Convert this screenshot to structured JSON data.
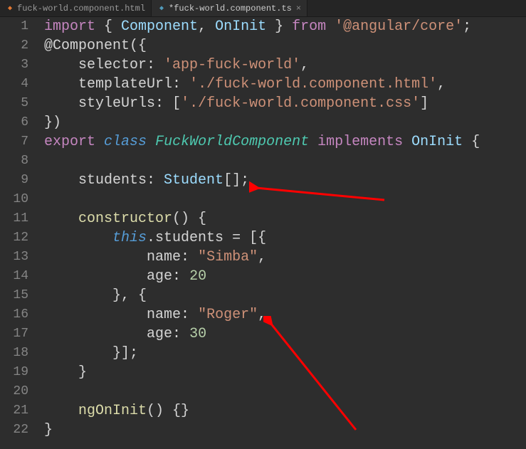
{
  "tabs": [
    {
      "label": "fuck-world.component.html",
      "modified": false,
      "active": false,
      "iconColor": "#e37933"
    },
    {
      "label": "*fuck-world.component.ts",
      "modified": true,
      "active": true,
      "iconColor": "#519aba"
    }
  ],
  "gutter": [
    "1",
    "2",
    "3",
    "4",
    "5",
    "6",
    "7",
    "8",
    "9",
    "10",
    "11",
    "12",
    "13",
    "14",
    "15",
    "16",
    "17",
    "18",
    "19",
    "20",
    "21",
    "22"
  ],
  "foldLines": [
    2,
    7,
    11,
    12,
    15
  ],
  "code": {
    "l1": {
      "import": "import",
      "open": " { ",
      "c1": "Component",
      "sep": ", ",
      "c2": "OnInit",
      "close": " } ",
      "from": "from",
      "sp": " ",
      "str": "'@angular/core'",
      "semi": ";"
    },
    "l2": {
      "dec": "@Component",
      "paren": "({"
    },
    "l3": {
      "indent": "    ",
      "key": "selector",
      "colon": ": ",
      "val": "'app-fuck-world'",
      "comma": ","
    },
    "l4": {
      "indent": "    ",
      "key": "templateUrl",
      "colon": ": ",
      "val": "'./fuck-world.component.html'",
      "comma": ","
    },
    "l5": {
      "indent": "    ",
      "key": "styleUrls",
      "colon": ": [",
      "val": "'./fuck-world.component.css'",
      "close": "]"
    },
    "l6": {
      "text": "})"
    },
    "l7": {
      "export": "export",
      "sp1": " ",
      "class": "class",
      "sp2": " ",
      "name": "FuckWorldComponent",
      "sp3": " ",
      "impl": "implements",
      "sp4": " ",
      "iface": "OnInit",
      "sp5": " {"
    },
    "l9": {
      "indent": "    ",
      "prop": "students",
      "colon": ": ",
      "type": "Student",
      "arr": "[];"
    },
    "l11": {
      "indent": "    ",
      "fn": "constructor",
      "rest": "() {"
    },
    "l12": {
      "indent": "        ",
      "this": "this",
      "dot": ".",
      "prop": "students",
      "eq": " = [{ "
    },
    "l13": {
      "indent": "            ",
      "key": "name",
      "colon": ": ",
      "val": "\"Simba\"",
      "comma": ","
    },
    "l14": {
      "indent": "            ",
      "key": "age",
      "colon": ": ",
      "val": "20"
    },
    "l15": {
      "indent": "        ",
      "text": "}, {"
    },
    "l16": {
      "indent": "            ",
      "key": "name",
      "colon": ": ",
      "val": "\"Roger\"",
      "comma": ","
    },
    "l17": {
      "indent": "            ",
      "key": "age",
      "colon": ": ",
      "val": "30"
    },
    "l18": {
      "indent": "        ",
      "text": "}];"
    },
    "l19": {
      "indent": "    ",
      "text": "}"
    },
    "l21": {
      "indent": "    ",
      "fn": "ngOnInit",
      "rest": "() {}"
    },
    "l22": {
      "text": "}"
    }
  }
}
